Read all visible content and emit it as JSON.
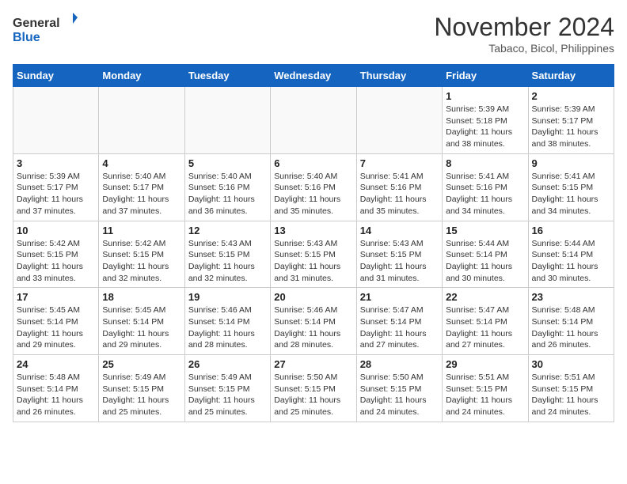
{
  "header": {
    "logo_general": "General",
    "logo_blue": "Blue",
    "month_title": "November 2024",
    "location": "Tabaco, Bicol, Philippines"
  },
  "days_of_week": [
    "Sunday",
    "Monday",
    "Tuesday",
    "Wednesday",
    "Thursday",
    "Friday",
    "Saturday"
  ],
  "weeks": [
    [
      {
        "day": "",
        "info": ""
      },
      {
        "day": "",
        "info": ""
      },
      {
        "day": "",
        "info": ""
      },
      {
        "day": "",
        "info": ""
      },
      {
        "day": "",
        "info": ""
      },
      {
        "day": "1",
        "info": "Sunrise: 5:39 AM\nSunset: 5:18 PM\nDaylight: 11 hours and 38 minutes."
      },
      {
        "day": "2",
        "info": "Sunrise: 5:39 AM\nSunset: 5:17 PM\nDaylight: 11 hours and 38 minutes."
      }
    ],
    [
      {
        "day": "3",
        "info": "Sunrise: 5:39 AM\nSunset: 5:17 PM\nDaylight: 11 hours and 37 minutes."
      },
      {
        "day": "4",
        "info": "Sunrise: 5:40 AM\nSunset: 5:17 PM\nDaylight: 11 hours and 37 minutes."
      },
      {
        "day": "5",
        "info": "Sunrise: 5:40 AM\nSunset: 5:16 PM\nDaylight: 11 hours and 36 minutes."
      },
      {
        "day": "6",
        "info": "Sunrise: 5:40 AM\nSunset: 5:16 PM\nDaylight: 11 hours and 35 minutes."
      },
      {
        "day": "7",
        "info": "Sunrise: 5:41 AM\nSunset: 5:16 PM\nDaylight: 11 hours and 35 minutes."
      },
      {
        "day": "8",
        "info": "Sunrise: 5:41 AM\nSunset: 5:16 PM\nDaylight: 11 hours and 34 minutes."
      },
      {
        "day": "9",
        "info": "Sunrise: 5:41 AM\nSunset: 5:15 PM\nDaylight: 11 hours and 34 minutes."
      }
    ],
    [
      {
        "day": "10",
        "info": "Sunrise: 5:42 AM\nSunset: 5:15 PM\nDaylight: 11 hours and 33 minutes."
      },
      {
        "day": "11",
        "info": "Sunrise: 5:42 AM\nSunset: 5:15 PM\nDaylight: 11 hours and 32 minutes."
      },
      {
        "day": "12",
        "info": "Sunrise: 5:43 AM\nSunset: 5:15 PM\nDaylight: 11 hours and 32 minutes."
      },
      {
        "day": "13",
        "info": "Sunrise: 5:43 AM\nSunset: 5:15 PM\nDaylight: 11 hours and 31 minutes."
      },
      {
        "day": "14",
        "info": "Sunrise: 5:43 AM\nSunset: 5:15 PM\nDaylight: 11 hours and 31 minutes."
      },
      {
        "day": "15",
        "info": "Sunrise: 5:44 AM\nSunset: 5:14 PM\nDaylight: 11 hours and 30 minutes."
      },
      {
        "day": "16",
        "info": "Sunrise: 5:44 AM\nSunset: 5:14 PM\nDaylight: 11 hours and 30 minutes."
      }
    ],
    [
      {
        "day": "17",
        "info": "Sunrise: 5:45 AM\nSunset: 5:14 PM\nDaylight: 11 hours and 29 minutes."
      },
      {
        "day": "18",
        "info": "Sunrise: 5:45 AM\nSunset: 5:14 PM\nDaylight: 11 hours and 29 minutes."
      },
      {
        "day": "19",
        "info": "Sunrise: 5:46 AM\nSunset: 5:14 PM\nDaylight: 11 hours and 28 minutes."
      },
      {
        "day": "20",
        "info": "Sunrise: 5:46 AM\nSunset: 5:14 PM\nDaylight: 11 hours and 28 minutes."
      },
      {
        "day": "21",
        "info": "Sunrise: 5:47 AM\nSunset: 5:14 PM\nDaylight: 11 hours and 27 minutes."
      },
      {
        "day": "22",
        "info": "Sunrise: 5:47 AM\nSunset: 5:14 PM\nDaylight: 11 hours and 27 minutes."
      },
      {
        "day": "23",
        "info": "Sunrise: 5:48 AM\nSunset: 5:14 PM\nDaylight: 11 hours and 26 minutes."
      }
    ],
    [
      {
        "day": "24",
        "info": "Sunrise: 5:48 AM\nSunset: 5:14 PM\nDaylight: 11 hours and 26 minutes."
      },
      {
        "day": "25",
        "info": "Sunrise: 5:49 AM\nSunset: 5:15 PM\nDaylight: 11 hours and 25 minutes."
      },
      {
        "day": "26",
        "info": "Sunrise: 5:49 AM\nSunset: 5:15 PM\nDaylight: 11 hours and 25 minutes."
      },
      {
        "day": "27",
        "info": "Sunrise: 5:50 AM\nSunset: 5:15 PM\nDaylight: 11 hours and 25 minutes."
      },
      {
        "day": "28",
        "info": "Sunrise: 5:50 AM\nSunset: 5:15 PM\nDaylight: 11 hours and 24 minutes."
      },
      {
        "day": "29",
        "info": "Sunrise: 5:51 AM\nSunset: 5:15 PM\nDaylight: 11 hours and 24 minutes."
      },
      {
        "day": "30",
        "info": "Sunrise: 5:51 AM\nSunset: 5:15 PM\nDaylight: 11 hours and 24 minutes."
      }
    ]
  ]
}
